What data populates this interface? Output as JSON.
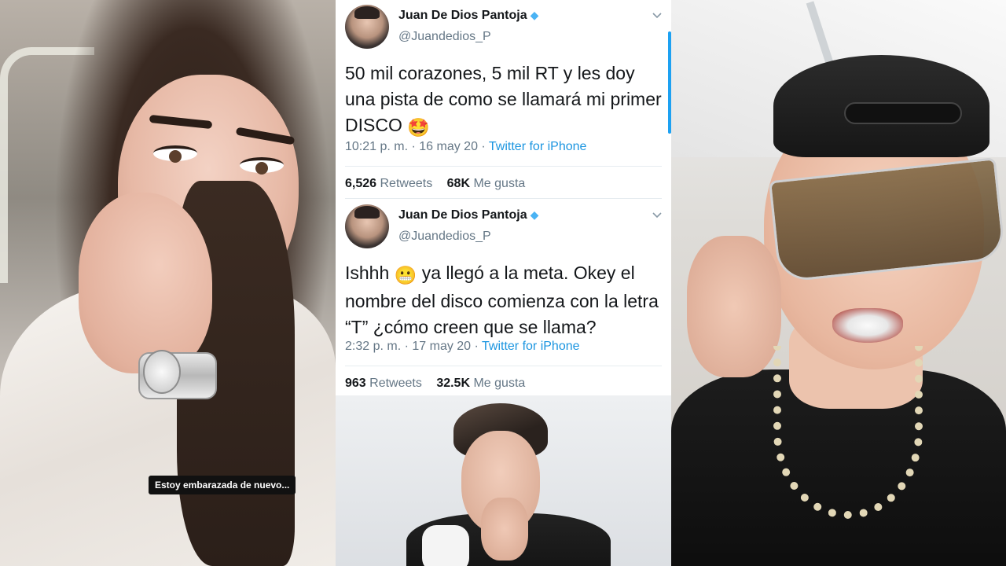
{
  "left_panel": {
    "caption": "Estoy embarazada de nuevo..."
  },
  "tweets": [
    {
      "name": "Juan De Dios Pantoja",
      "verified": "verified-badge-icon",
      "handle": "@Juandedios_P",
      "text": "50 mil corazones, 5 mil RT y les doy una pista de como se llamará mi primer DISCO",
      "emoji": "🤩",
      "time": "10:21 p. m. · 16 may 20 · ",
      "source": "Twitter for iPhone",
      "retweets_count": "6,526",
      "retweets_label": "Retweets",
      "likes_count": "68K",
      "likes_label": "Me gusta"
    },
    {
      "name": "Juan De Dios Pantoja",
      "verified": "verified-badge-icon",
      "handle": "@Juandedios_P",
      "text_before": "Ishhh",
      "emoji": "😬",
      "text_after": "ya llegó a la meta. Okey el nombre del disco comienza con la letra “T” ¿cómo creen que se llama?",
      "time": "2:32 p. m. · 17 may 20 · ",
      "source": "Twitter for iPhone",
      "retweets_count": "963",
      "retweets_label": "Retweets",
      "likes_count": "32.5K",
      "likes_label": "Me gusta"
    }
  ],
  "colors": {
    "link_blue": "#1b95e0",
    "verified_blue": "#4ab3f4",
    "text_dark": "#14171a",
    "text_gray": "#657786"
  }
}
